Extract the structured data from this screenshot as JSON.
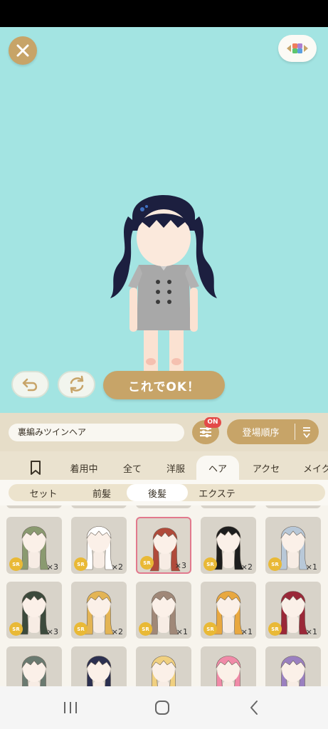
{
  "outfit_name": "裏編みツインヘア",
  "ok_label": "これでOK！",
  "filter_badge": "ON",
  "sort_label": "登場順序",
  "tabs": [
    {
      "label": "",
      "icon": "bookmark-icon"
    },
    {
      "label": "着用中"
    },
    {
      "label": "全て"
    },
    {
      "label": "洋服"
    },
    {
      "label": "ヘア",
      "active": true
    },
    {
      "label": "アクセ"
    },
    {
      "label": "メイク"
    }
  ],
  "subtabs": [
    {
      "label": "セット"
    },
    {
      "label": "前髪"
    },
    {
      "label": "後髪",
      "active": true
    },
    {
      "label": "エクステ"
    }
  ],
  "grid": {
    "rarity": "SR",
    "row1": [
      {
        "count": "×3",
        "hair_color": "#8a9a70"
      },
      {
        "count": "×2",
        "hair_color": "#ffffff"
      },
      {
        "count": "×3",
        "hair_color": "#b04a3a",
        "selected": true
      },
      {
        "count": "×2",
        "hair_color": "#1e1e1e"
      },
      {
        "count": "×1",
        "hair_color": "#b8c8d8"
      }
    ],
    "row2": [
      {
        "count": "×3",
        "hair_color": "#3c4a3c"
      },
      {
        "count": "×2",
        "hair_color": "#e3b454"
      },
      {
        "count": "×1",
        "hair_color": "#a08878"
      },
      {
        "count": "×1",
        "hair_color": "#e8a840"
      },
      {
        "count": "×1",
        "hair_color": "#9a2838"
      }
    ],
    "row3_colors": [
      "#6a7a70",
      "#2c3050",
      "#f0d080",
      "#f08aa8",
      "#9a80c0"
    ]
  },
  "colors": {
    "stage_bg": "#a3e4e2",
    "accent_gold": "#c7a468",
    "sr_badge": "#e9b936",
    "selected_border": "#e2798d"
  }
}
